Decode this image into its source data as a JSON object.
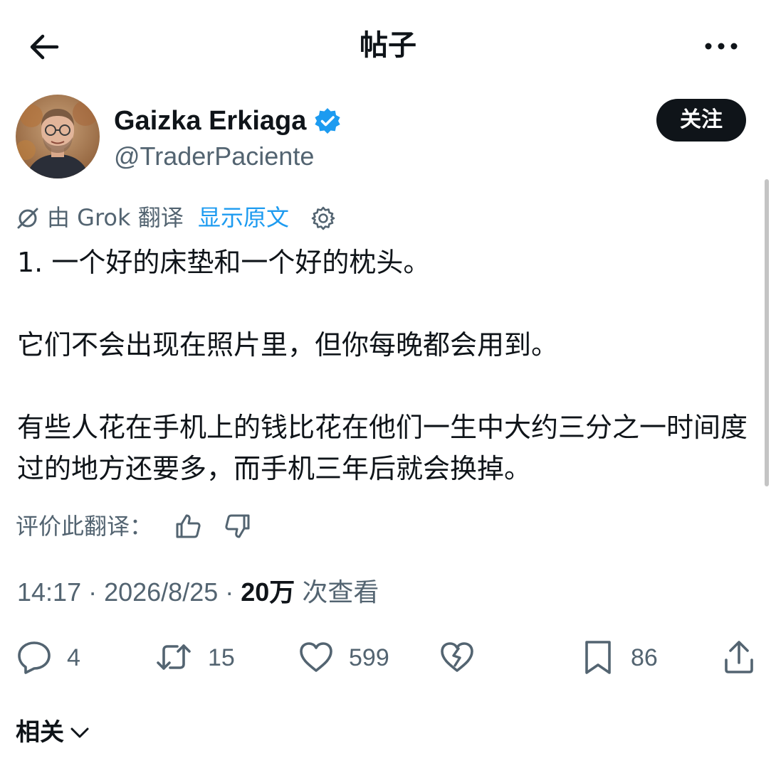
{
  "header": {
    "title": "帖子",
    "back_icon": "arrow-left-icon",
    "more_icon": "more-horizontal-icon"
  },
  "author": {
    "display_name": "Gaizka Erkiaga",
    "handle": "@TraderPaciente",
    "verified": true,
    "verified_color": "#1d9bf0",
    "follow_label": "关注"
  },
  "translation": {
    "label": "由 Grok 翻译",
    "show_original": "显示原文",
    "rate_label": "评价此翻译：",
    "link_color": "#1d9bf0"
  },
  "post": {
    "paragraphs": [
      "1. 一个好的床垫和一个好的枕头。",
      "它们不会出现在照片里，但你每晚都会用到。",
      "有些人花在手机上的钱比花在他们一生中大约三分之一时间度过的地方还要多，而手机三年后就会换掉。"
    ]
  },
  "meta": {
    "time": "14:17",
    "separator": " · ",
    "date": "2026/8/25",
    "views_count": "20万",
    "views_label": "次查看"
  },
  "actions": {
    "replies": "4",
    "reposts": "15",
    "likes": "599",
    "bookmarks": "86"
  },
  "related": {
    "label": "相关"
  },
  "colors": {
    "text": "#0f1419",
    "secondary": "#536471",
    "follow_bg": "#0f1419"
  }
}
